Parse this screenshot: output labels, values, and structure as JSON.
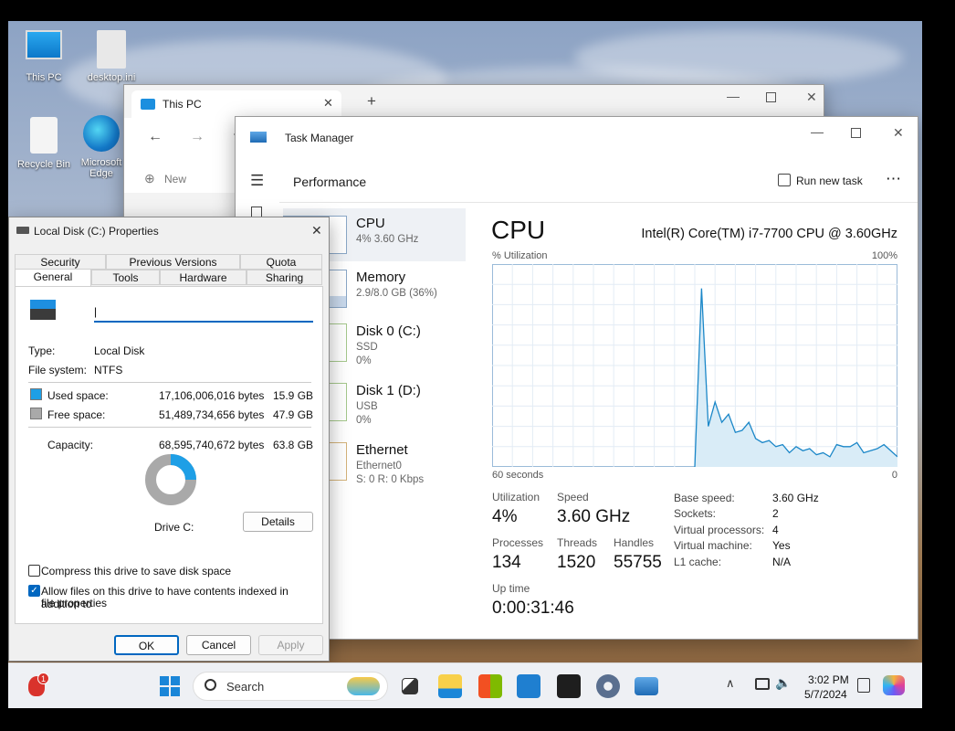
{
  "desktop": {
    "icons": [
      {
        "label": "This PC"
      },
      {
        "label": "desktop.ini"
      },
      {
        "label": "Recycle Bin"
      },
      {
        "label": "Microsoft Edge"
      }
    ]
  },
  "explorer": {
    "tab_title": "This PC",
    "new_tab": "+",
    "new_label": "New"
  },
  "taskmgr": {
    "app_title": "Task Manager",
    "page_title": "Performance",
    "run_new_task": "Run new task",
    "more": "⋯",
    "sidebar": [
      {
        "name": "CPU",
        "sub1": "4% 3.60 GHz",
        "sub2": ""
      },
      {
        "name": "Memory",
        "sub1": "2.9/8.0 GB (36%)",
        "sub2": ""
      },
      {
        "name": "Disk 0 (C:)",
        "sub1": "SSD",
        "sub2": "0%"
      },
      {
        "name": "Disk 1 (D:)",
        "sub1": "USB",
        "sub2": "0%"
      },
      {
        "name": "Ethernet",
        "sub1": "Ethernet0",
        "sub2": "S: 0 R: 0 Kbps"
      }
    ],
    "cpu": {
      "heading": "CPU",
      "model": "Intel(R) Core(TM) i7-7700 CPU @ 3.60GHz",
      "graph_label": "% Utilization",
      "graph_max": "100%",
      "graph_span": "60 seconds",
      "graph_min": "0",
      "utilization_label": "Utilization",
      "utilization": "4%",
      "speed_label": "Speed",
      "speed": "3.60 GHz",
      "processes_label": "Processes",
      "processes": "134",
      "threads_label": "Threads",
      "threads": "1520",
      "handles_label": "Handles",
      "handles": "55755",
      "uptime_label": "Up time",
      "uptime": "0:00:31:46",
      "specs": [
        {
          "k": "Base speed:",
          "v": "3.60 GHz"
        },
        {
          "k": "Sockets:",
          "v": "2"
        },
        {
          "k": "Virtual processors:",
          "v": "4"
        },
        {
          "k": "Virtual machine:",
          "v": "Yes"
        },
        {
          "k": "L1 cache:",
          "v": "N/A"
        }
      ]
    }
  },
  "chart_data": {
    "type": "area",
    "title": "% Utilization",
    "xlabel": "60 seconds",
    "ylabel": "",
    "ylim": [
      0,
      100
    ],
    "xlim": [
      60,
      0
    ],
    "x": [
      60,
      59,
      58,
      57,
      56,
      55,
      54,
      53,
      52,
      51,
      50,
      49,
      48,
      47,
      46,
      45,
      44,
      43,
      42,
      41,
      40,
      39,
      38,
      37,
      36,
      35,
      34,
      33,
      32,
      31,
      30,
      29,
      28,
      27,
      26,
      25,
      24,
      23,
      22,
      21,
      20,
      19,
      18,
      17,
      16,
      15,
      14,
      13,
      12,
      11,
      10,
      9,
      8,
      7,
      6,
      5,
      4,
      3,
      2,
      1,
      0
    ],
    "series": [
      {
        "values": [
          0,
          0,
          0,
          0,
          0,
          0,
          0,
          0,
          0,
          0,
          0,
          0,
          0,
          0,
          0,
          0,
          0,
          0,
          0,
          0,
          0,
          0,
          0,
          0,
          0,
          0,
          0,
          0,
          0,
          0,
          0,
          88,
          20,
          32,
          22,
          26,
          17,
          18,
          22,
          14,
          12,
          13,
          10,
          11,
          7,
          10,
          8,
          9,
          6,
          7,
          5,
          11,
          10,
          10,
          12,
          7,
          8,
          9,
          11,
          8,
          5
        ]
      }
    ]
  },
  "props": {
    "title": "Local Disk (C:) Properties",
    "tabs_row1": [
      "Security",
      "Previous Versions",
      "Quota"
    ],
    "tabs_row2": [
      "General",
      "Tools",
      "Hardware",
      "Sharing"
    ],
    "name_value": "|",
    "type_label": "Type:",
    "type_value": "Local Disk",
    "fs_label": "File system:",
    "fs_value": "NTFS",
    "used_label": "Used space:",
    "used_bytes": "17,106,006,016 bytes",
    "used_gb": "15.9 GB",
    "free_label": "Free space:",
    "free_bytes": "51,489,734,656 bytes",
    "free_gb": "47.9 GB",
    "cap_label": "Capacity:",
    "cap_bytes": "68,595,740,672 bytes",
    "cap_gb": "63.8 GB",
    "used_fraction": 0.25,
    "drive_label": "Drive C:",
    "details": "Details",
    "compress": "Compress this drive to save disk space",
    "index": "Allow files on this drive to have contents indexed in addition to",
    "index2": "file properties",
    "ok": "OK",
    "cancel": "Cancel",
    "apply": "Apply",
    "used_color": "#1e9fe6",
    "free_color": "#a9a9a9"
  },
  "taskbar": {
    "search": "Search",
    "time": "3:02 PM",
    "date": "5/7/2024",
    "badge": "1"
  }
}
